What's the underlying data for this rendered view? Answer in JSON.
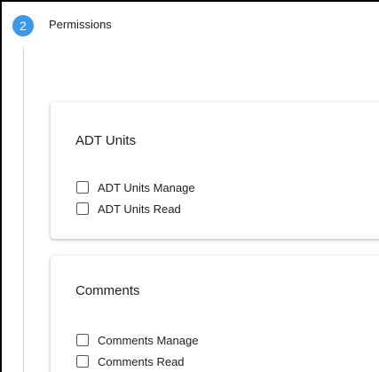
{
  "step": {
    "number": "2",
    "title": "Permissions",
    "accent_color": "#3b97e8"
  },
  "groups": [
    {
      "title": "ADT Units",
      "permissions": [
        {
          "label": "ADT Units Manage",
          "checked": false
        },
        {
          "label": "ADT Units Read",
          "checked": false
        }
      ]
    },
    {
      "title": "Comments",
      "permissions": [
        {
          "label": "Comments Manage",
          "checked": false
        },
        {
          "label": "Comments Read",
          "checked": false
        }
      ]
    }
  ]
}
